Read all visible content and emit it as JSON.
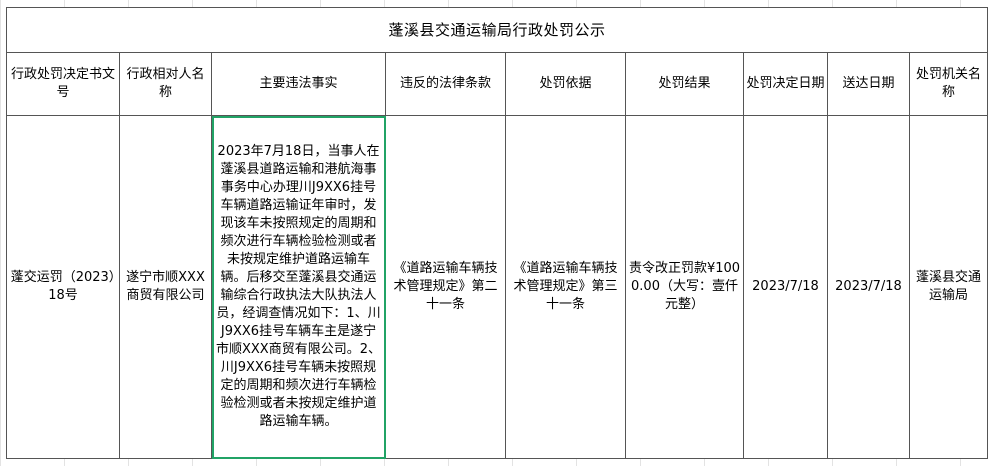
{
  "title": "蓬溪县交通运输局行政处罚公示",
  "headers": {
    "doc_no": "行政处罚决定书文号",
    "party": "行政相对人名称",
    "facts": "主要违法事实",
    "law": "违反的法律条款",
    "basis": "处罚依据",
    "result": "处罚结果",
    "decision_date": "处罚决定日期",
    "delivery_date": "送达日期",
    "authority": "处罚机关名称"
  },
  "row": {
    "doc_no": "蓬交运罚（2023）18号",
    "party": "遂宁市顺XXX商贸有限公司",
    "facts": "2023年7月18日，当事人在蓬溪县道路运输和港航海事事务中心办理川J9XX6挂号车辆道路运输证年审时，发现该车未按照规定的周期和频次进行车辆检验检测或者未按规定维护道路运输车辆。后移交至蓬溪县交通运输综合行政执法大队执法人员，经调查情况如下：1、川J9XX6挂号车辆车主是遂宁市顺XXX商贸有限公司。2、川J9XX6挂号车辆未按照规定的周期和频次进行车辆检验检测或者未按规定维护道路运输车辆。",
    "law": "《道路运输车辆技术管理规定》第二十一条",
    "basis": "《道路运输车辆技术管理规定》第三十一条",
    "result": "责令改正罚款¥1000.00（大写：壹仟元整）",
    "decision_date": "2023/7/18",
    "delivery_date": "2023/7/18",
    "authority": "蓬溪县交通运输局"
  }
}
